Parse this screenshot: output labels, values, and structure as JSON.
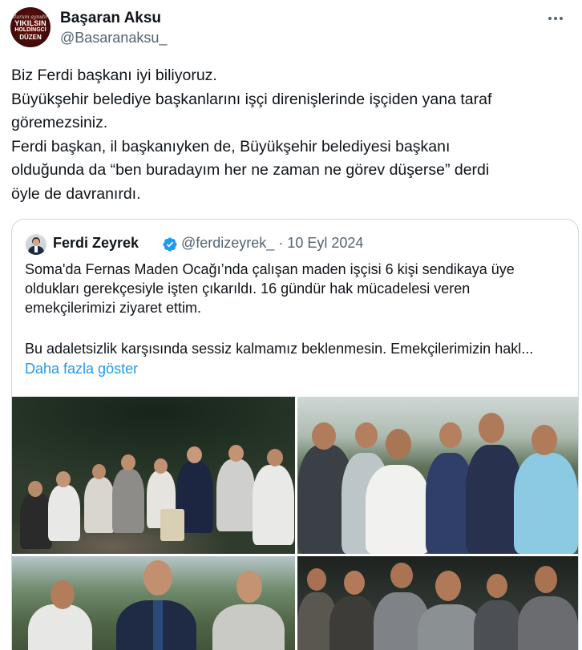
{
  "tweet": {
    "author": {
      "name": "Başaran Aksu",
      "handle": "@Basaranaksu_",
      "avatar_text": [
        "durum aynıdır",
        "YIKILSIN",
        "HOLDİNGCİ",
        "DÜZEN"
      ]
    },
    "text_lines": [
      "Biz Ferdi başkanı iyi biliyoruz.",
      "Büyükşehir belediye başkanlarını işçi direnişlerinde işçiden yana taraf",
      "göremezsiniz.",
      "Ferdi başkan, il başkanıyken de, Büyükşehir belediyesi başkanı",
      "olduğunda da “ben buradayım her ne zaman ne görev düşerse” derdi",
      "öyle de davranırdı."
    ]
  },
  "quoted": {
    "name": "Ferdi Zeyrek",
    "verified": true,
    "meta": "@ferdizeyrek_ · 10 Eyl 2024",
    "text_lines": [
      "Soma'da Fernas Maden Ocağı’nda çalışan maden işçisi 6 kişi sendikaya üye",
      "oldukları gerekçesiyle işten çıkarıldı. 16 gündür hak mücadelesi veren",
      "emekçilerimizi ziyaret ettim."
    ],
    "text_line_after_gap": "Bu adaletsizlik karşısında sessiz kalmamız beklenmesin. Emekçilerimizin hakl...",
    "show_more": "Daha fazla göster",
    "photo_count": 4
  },
  "colors": {
    "text": "#0f1419",
    "secondary": "#536471",
    "link": "#1d9bf0",
    "border": "#cfd9de",
    "verified": "#1d9bf0",
    "avatar_bg": "#5a0f0c"
  },
  "icons": [
    "more-icon",
    "verified-badge-icon"
  ]
}
